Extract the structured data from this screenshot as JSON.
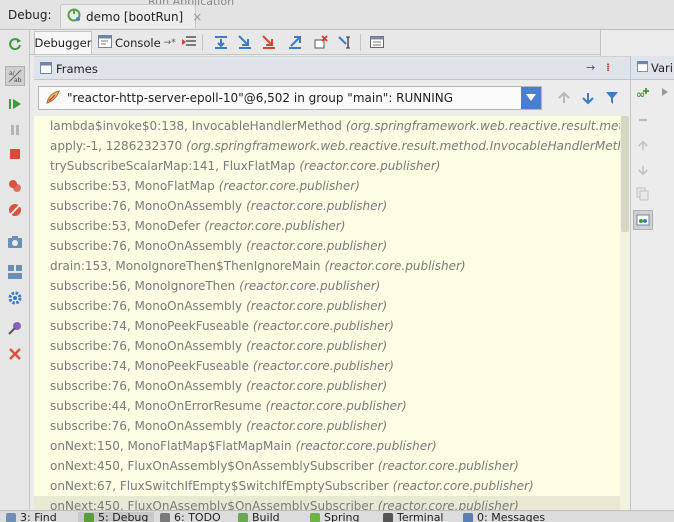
{
  "window": {
    "debug_label": "Debug:",
    "background_label": "Run Application",
    "run_tab": {
      "title": "demo [bootRun]",
      "close": "×"
    }
  },
  "toolbar": {
    "tabs": [
      {
        "label": "Debugger",
        "active": true
      },
      {
        "label": "Console",
        "suffix": "→*",
        "active": false
      }
    ],
    "icons": [
      "show-execution-point-icon",
      "step-over-icon",
      "step-into-icon",
      "force-step-into-icon",
      "step-out-icon",
      "drop-frame-icon",
      "run-to-cursor-icon",
      "evaluate-expression-icon"
    ]
  },
  "left_toolbar": {
    "icons": [
      "rerun-icon",
      "restore-layout-icon",
      "resume-icon",
      "pause-icon",
      "stop-icon",
      "view-breakpoints-icon",
      "mute-breakpoints-icon",
      "camera-icon",
      "layout-icon",
      "settings-icon",
      "pin-icon",
      "close-icon"
    ]
  },
  "frames_panel": {
    "title": "Frames",
    "header_controls": {
      "pin": "→",
      "collapse": "⁞"
    },
    "thread": "\"reactor-http-server-epoll-10\"@6,502 in group \"main\": RUNNING",
    "frames": [
      {
        "method": "lambda$invoke$0:138, InvocableHandlerMethod",
        "pkg": "(org.springframework.web.reactive.result.method)"
      },
      {
        "method": "apply:-1, 1286232370",
        "pkg": "(org.springframework.web.reactive.result.method.InvocableHandlerMethod$$Lambda$"
      },
      {
        "method": "trySubscribeScalarMap:141, FluxFlatMap",
        "pkg": "(reactor.core.publisher)"
      },
      {
        "method": "subscribe:53, MonoFlatMap",
        "pkg": "(reactor.core.publisher)"
      },
      {
        "method": "subscribe:76, MonoOnAssembly",
        "pkg": "(reactor.core.publisher)"
      },
      {
        "method": "subscribe:53, MonoDefer",
        "pkg": "(reactor.core.publisher)"
      },
      {
        "method": "subscribe:76, MonoOnAssembly",
        "pkg": "(reactor.core.publisher)"
      },
      {
        "method": "drain:153, MonoIgnoreThen$ThenIgnoreMain",
        "pkg": "(reactor.core.publisher)"
      },
      {
        "method": "subscribe:56, MonoIgnoreThen",
        "pkg": "(reactor.core.publisher)"
      },
      {
        "method": "subscribe:76, MonoOnAssembly",
        "pkg": "(reactor.core.publisher)"
      },
      {
        "method": "subscribe:74, MonoPeekFuseable",
        "pkg": "(reactor.core.publisher)"
      },
      {
        "method": "subscribe:76, MonoOnAssembly",
        "pkg": "(reactor.core.publisher)"
      },
      {
        "method": "subscribe:74, MonoPeekFuseable",
        "pkg": "(reactor.core.publisher)"
      },
      {
        "method": "subscribe:76, MonoOnAssembly",
        "pkg": "(reactor.core.publisher)"
      },
      {
        "method": "subscribe:44, MonoOnErrorResume",
        "pkg": "(reactor.core.publisher)"
      },
      {
        "method": "subscribe:76, MonoOnAssembly",
        "pkg": "(reactor.core.publisher)"
      },
      {
        "method": "onNext:150, MonoFlatMap$FlatMapMain",
        "pkg": "(reactor.core.publisher)"
      },
      {
        "method": "onNext:450, FluxOnAssembly$OnAssemblySubscriber",
        "pkg": "(reactor.core.publisher)"
      },
      {
        "method": "onNext:67, FluxSwitchIfEmpty$SwitchIfEmptySubscriber",
        "pkg": "(reactor.core.publisher)"
      },
      {
        "method": "onNext:450, FluxOnAssembly$OnAssemblySubscriber",
        "pkg": "(reactor.core.publisher)"
      }
    ]
  },
  "variables_panel": {
    "title": "Vari",
    "icons": [
      "new-watch-icon",
      "remove-watch-icon",
      "move-up-icon",
      "move-down-icon",
      "copy-icon",
      "watches-toggle-icon"
    ]
  },
  "bottom_bar": {
    "items": [
      {
        "label": "3: Find",
        "color": "#6d8fb5",
        "active": false
      },
      {
        "label": "5: Debug",
        "color": "#5a9e3a",
        "active": true
      },
      {
        "label": "6: TODO",
        "color": "#7a7a7a",
        "active": false
      },
      {
        "label": "Build",
        "color": "#6aa84f",
        "active": false
      },
      {
        "label": "Spring",
        "color": "#6db33f",
        "active": false
      },
      {
        "label": "Terminal",
        "color": "#555555",
        "active": false
      },
      {
        "label": "0: Messages",
        "color": "#5b7fb1",
        "active": false
      }
    ]
  },
  "colors": {
    "frames_bg": "#fdfde4",
    "accent_blue": "#4a7fd0",
    "frame_text": "#7a7a7a"
  }
}
